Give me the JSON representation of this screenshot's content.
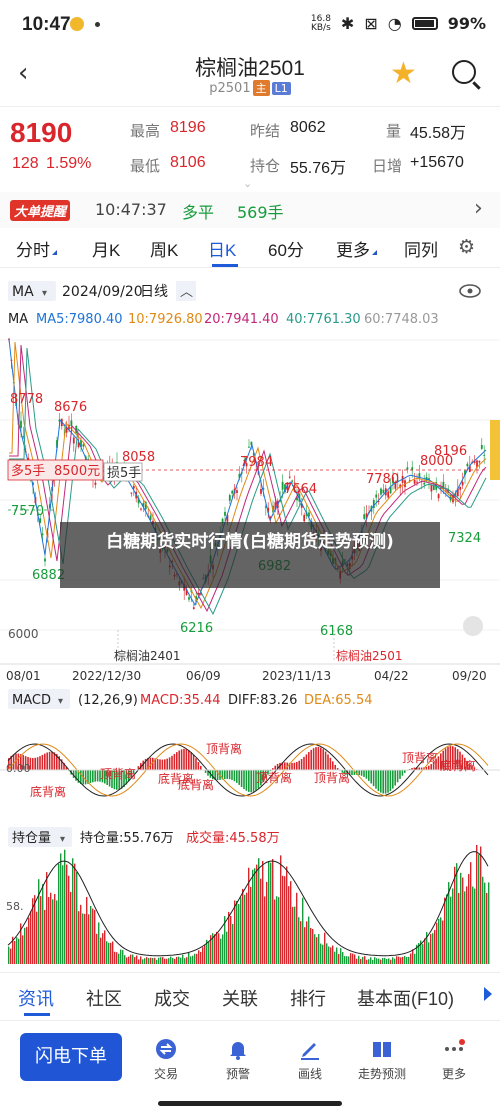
{
  "status": {
    "time": "10:47",
    "net_speed_top": "16.8",
    "net_speed_unit": "KB/s",
    "battery": "99%"
  },
  "nav": {
    "title": "棕榈油2501",
    "code": "p2501",
    "tag1": "主",
    "tag2": "L1"
  },
  "quote": {
    "price": "8190",
    "change": "128",
    "change_pct": "1.59%",
    "high_label": "最高",
    "high": "8196",
    "low_label": "最低",
    "low": "8106",
    "prev_settle_label": "昨结",
    "prev_settle": "8062",
    "open_int_label": "持仓",
    "open_int": "55.76万",
    "volume_label": "量",
    "volume": "45.58万",
    "daily_inc_label": "日增",
    "daily_inc": "+15670"
  },
  "alert": {
    "badge": "大单提醒",
    "time": "10:47:37",
    "type": "多平",
    "qty": "569手"
  },
  "tabs": [
    "分时",
    "月K",
    "周K",
    "日K",
    "60分",
    "更多",
    "同列"
  ],
  "chart_header": {
    "indicator": "MA",
    "date": "2024/09/20",
    "period": "日线"
  },
  "ma_line": {
    "ma": "MA",
    "ma5": "MA5:7980.40",
    "ma10": "10:7926.80",
    "ma20": "20:7941.40",
    "ma40": "40:7761.30",
    "ma60": "60:7748.03"
  },
  "price_labels": {
    "p8778": "8778",
    "p8676": "8676",
    "p8058": "8058",
    "p7984": "7984",
    "p7664": "7664",
    "p7780": "7780",
    "p8000": "8000",
    "p8196": "8196",
    "p7570": "7570",
    "p6882": "6882",
    "p6982": "6982",
    "p7324": "7324",
    "p6216": "6216",
    "p6168": "6168",
    "p6000": "6000"
  },
  "order_tags": {
    "long": "多5手",
    "long_price": "8500元",
    "stop": "损5手"
  },
  "contract_labels": {
    "c1": "棕榈油2401",
    "c2": "棕榈油2501"
  },
  "dates": [
    "08/01",
    "2022/12/30",
    "06/09",
    "2023/11/13",
    "04/22",
    "09/20"
  ],
  "macd": {
    "label": "MACD",
    "params": "(12,26,9)",
    "macd": "MACD:35.44",
    "diff": "DIFF:83.26",
    "dea": "DEA:65.54",
    "zero": "0.00",
    "top1": "顶背离",
    "top2": "顶背离",
    "top3": "顶背离",
    "top4": "顶背离",
    "top5": "顶背离",
    "bot1": "底背离",
    "bot2": "底背离",
    "bot3": "底背离",
    "bot4": "底背离"
  },
  "oi": {
    "label": "持仓量",
    "oi": "持仓量:55.76万",
    "vol": "成交量:45.58万",
    "axis": "58."
  },
  "overlay": {
    "text": "白糖期货实时行情(白糖期货走势预测)"
  },
  "bottom_tabs": [
    "资讯",
    "社区",
    "成交",
    "关联",
    "排行",
    "基本面(F10)"
  ],
  "toolbar": {
    "flash": "闪电下单",
    "t1": "交易",
    "t2": "预警",
    "t3": "画线",
    "t4": "走势预测",
    "t5": "更多"
  },
  "colors": {
    "up": "#d9262c",
    "down": "#179c3c",
    "accent": "#1e5bd8"
  }
}
